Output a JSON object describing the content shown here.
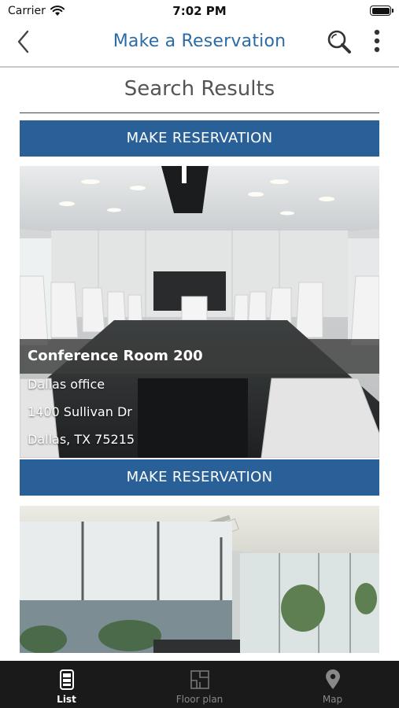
{
  "status_bar": {
    "carrier": "Carrier",
    "time": "7:02 PM"
  },
  "nav": {
    "title": "Make a Reservation"
  },
  "section": {
    "title": "Search Results"
  },
  "reserve_label": "MAKE RESERVATION",
  "results": [
    {
      "name": "Conference Room 200",
      "office": "Dallas office",
      "address": "1400 Sullivan Dr",
      "city": "Dallas, TX 75215"
    }
  ],
  "tabs": [
    {
      "label": "List",
      "icon": "list-icon",
      "active": true
    },
    {
      "label": "Floor plan",
      "icon": "floor-plan-icon",
      "active": false
    },
    {
      "label": "Map",
      "icon": "map-pin-icon",
      "active": false
    }
  ],
  "colors": {
    "accent": "#2b6ca8",
    "button": "#2a6098",
    "tab_bar": "#1a1a1a"
  }
}
